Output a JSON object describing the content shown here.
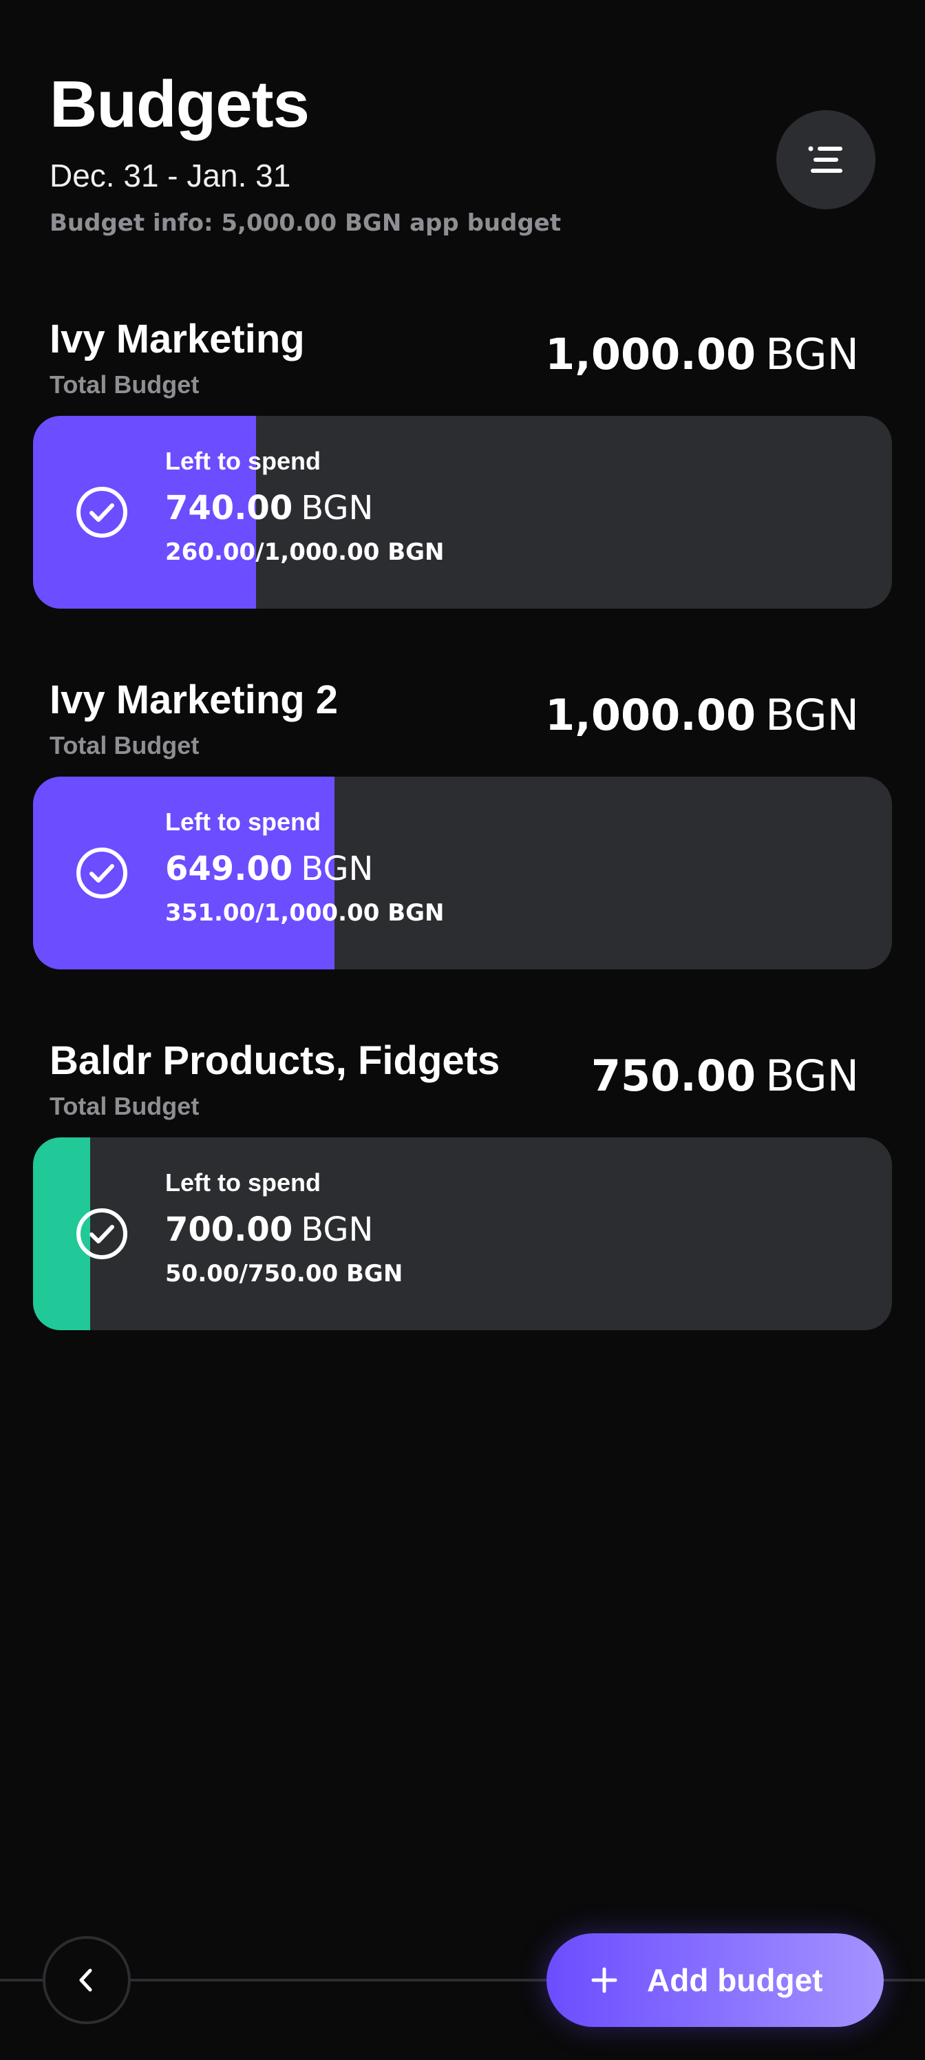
{
  "header": {
    "title": "Budgets",
    "period": "Dec. 31 - Jan. 31",
    "info": "Budget info: 5,000.00 BGN app budget"
  },
  "menu_icon": "list-menu-icon",
  "budgets": [
    {
      "name": "Ivy Marketing",
      "subtitle": "Total Budget",
      "total_amount": "1,000.00",
      "currency": "BGN",
      "left_label": "Left to spend",
      "left_amount": "740.00",
      "left_currency": "BGN",
      "spent_ratio": "260.00/1,000.00 BGN",
      "progress": 0.26,
      "color": "#6c4dff"
    },
    {
      "name": "Ivy Marketing 2",
      "subtitle": "Total Budget",
      "total_amount": "1,000.00",
      "currency": "BGN",
      "left_label": "Left to spend",
      "left_amount": "649.00",
      "left_currency": "BGN",
      "spent_ratio": "351.00/1,000.00 BGN",
      "progress": 0.351,
      "color": "#6c4dff"
    },
    {
      "name": "Baldr Products, Fidgets",
      "subtitle": "Total Budget",
      "total_amount": "750.00",
      "currency": "BGN",
      "left_label": "Left to spend",
      "left_amount": "700.00",
      "left_currency": "BGN",
      "spent_ratio": "50.00/750.00 BGN",
      "progress": 0.0667,
      "color": "#20c997"
    }
  ],
  "footer": {
    "back_icon": "chevron-left-icon",
    "add_label": "Add budget",
    "add_icon": "plus-icon"
  },
  "colors": {
    "background": "#0a0a0b",
    "card": "#2c2d30",
    "accent": "#6c4dff",
    "green": "#20c997",
    "muted": "#8e8e93"
  }
}
